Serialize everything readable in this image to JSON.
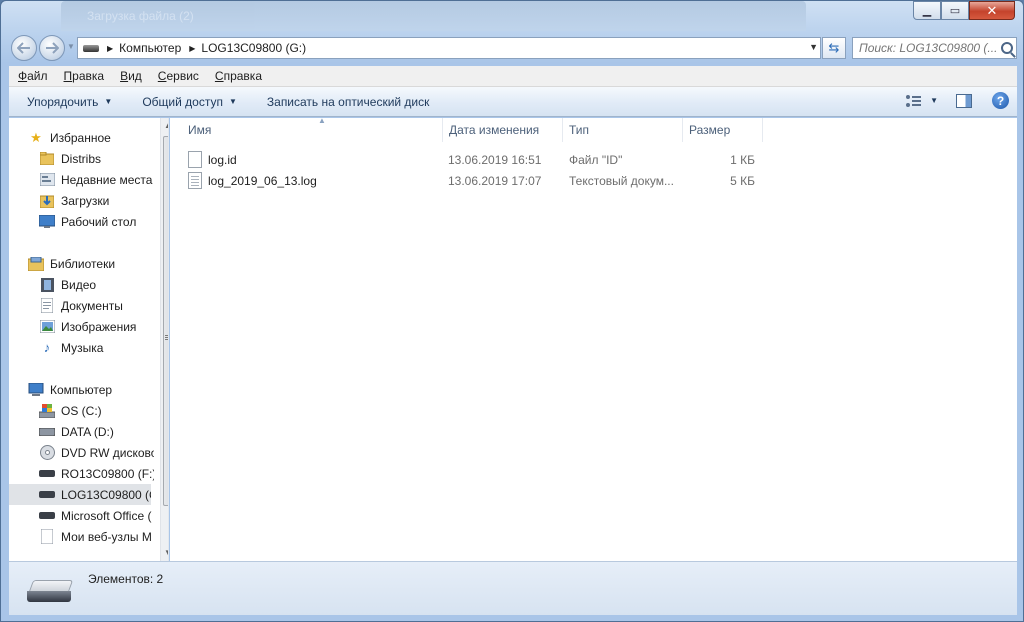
{
  "window": {
    "background_title": "Загрузка файла (2)",
    "minimize": "▁",
    "maximize": "▭",
    "close": "✕"
  },
  "address_bar": {
    "separator": "▶",
    "crumbs": [
      "Компьютер",
      "LOG13C09800 (G:)"
    ],
    "refresh_glyph": "⇆",
    "search_placeholder": "Поиск: LOG13C09800 (..."
  },
  "menu": {
    "items": [
      {
        "accel": "Ф",
        "rest": "айл"
      },
      {
        "accel": "П",
        "rest": "равка"
      },
      {
        "accel": "В",
        "rest": "ид"
      },
      {
        "accel": "С",
        "rest": "ервис"
      },
      {
        "accel": "С",
        "rest": "правка"
      }
    ]
  },
  "toolbar": {
    "organize": "Упорядочить",
    "share": "Общий доступ",
    "burn": "Записать на оптический диск",
    "dropdown_glyph": "▼",
    "help": "?"
  },
  "nav_pane": {
    "favorites": {
      "label": "Избранное",
      "items": [
        "Distribs",
        "Недавние места",
        "Загрузки",
        "Рабочий стол"
      ]
    },
    "libraries": {
      "label": "Библиотеки",
      "items": [
        "Видео",
        "Документы",
        "Изображения",
        "Музыка"
      ]
    },
    "computer": {
      "label": "Компьютер",
      "items": [
        "OS (C:)",
        "DATA (D:)",
        "DVD RW дисково",
        "RO13C09800 (F:)",
        "LOG13C09800 (G:",
        "Microsoft Office (",
        "Мои веб-узлы М"
      ]
    },
    "selected": "LOG13C09800 (G:",
    "icons": {
      "favorites": "star-icon",
      "folder": "folder-icon",
      "recent": "recent-places-icon",
      "downloads": "downloads-icon",
      "desktop": "desktop-icon",
      "libraries": "library-icon",
      "video": "video-icon",
      "documents": "documents-icon",
      "images": "pictures-icon",
      "music": "music-icon",
      "computer": "computer-icon",
      "drive": "drive-icon",
      "dvd": "dvd-icon"
    }
  },
  "file_list": {
    "columns": [
      "Имя",
      "Дата изменения",
      "Тип",
      "Размер"
    ],
    "rows": [
      {
        "name": "log.id",
        "date": "13.06.2019 16:51",
        "type": "Файл \"ID\"",
        "size": "1 КБ"
      },
      {
        "name": "log_2019_06_13.log",
        "date": "13.06.2019 17:07",
        "type": "Текстовый докум...",
        "size": "5 КБ"
      }
    ]
  },
  "status_bar": {
    "text": "Элементов: 2"
  },
  "colors": {
    "frame": "#a9c5e8",
    "toolbar": "#e1ebf7",
    "text_muted": "#6d6d6d",
    "selection": "#e0e3e7"
  }
}
